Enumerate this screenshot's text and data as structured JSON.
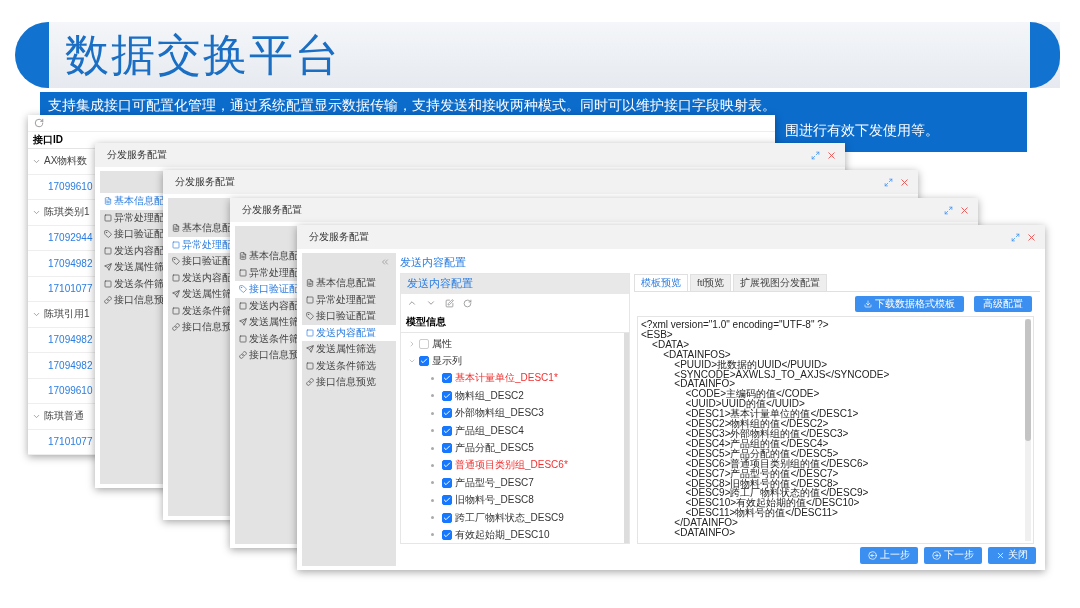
{
  "header": {
    "title": "数据交换平台"
  },
  "description": {
    "lines": [
      "支持集成接口可配置化管理，通过系统配置显示数据传输，支持发送和接收两种模式。同时可以维护接口字段映射表。",
      "围进行有效下发使用等。"
    ]
  },
  "table_window": {
    "column": "接口ID",
    "groups": [
      {
        "label": "AX物料数",
        "expanded": true,
        "rows": [
          "17099610"
        ]
      },
      {
        "label": "陈琪类别1",
        "expanded": true,
        "rows": [
          "17092944",
          "17094982",
          "17101077"
        ]
      },
      {
        "label": "陈琪引用1",
        "expanded": true,
        "rows": [
          "17094982",
          "17094982",
          "17099610"
        ]
      },
      {
        "label": "陈琪普通",
        "expanded": true,
        "rows": [
          "17101077"
        ]
      }
    ]
  },
  "back_windows": [
    {
      "title": "分发服务配置",
      "menu": [
        {
          "label": "基本信息配",
          "selected": true
        },
        {
          "label": "异常处理配",
          "selected": false
        },
        {
          "label": "接口验证配",
          "selected": false
        },
        {
          "label": "发送内容配",
          "selected": false
        },
        {
          "label": "发送属性筛",
          "selected": false
        },
        {
          "label": "发送条件筛",
          "selected": false
        },
        {
          "label": "接口信息预",
          "selected": false
        }
      ]
    },
    {
      "title": "分发服务配置",
      "menu": [
        {
          "label": "基本信息配",
          "selected": false
        },
        {
          "label": "异常处理配",
          "selected": true
        },
        {
          "label": "接口验证配",
          "selected": false
        },
        {
          "label": "发送内容配",
          "selected": false
        },
        {
          "label": "发送属性筛",
          "selected": false
        },
        {
          "label": "发送条件筛",
          "selected": false
        },
        {
          "label": "接口信息预",
          "selected": false
        }
      ]
    },
    {
      "title": "分发服务配置",
      "menu": [
        {
          "label": "基本信息配",
          "selected": false
        },
        {
          "label": "异常处理配",
          "selected": false
        },
        {
          "label": "接口验证配",
          "selected": true
        },
        {
          "label": "发送内容配",
          "selected": false
        },
        {
          "label": "发送属性筛",
          "selected": false
        },
        {
          "label": "发送条件筛",
          "selected": false
        },
        {
          "label": "接口信息预",
          "selected": false
        }
      ]
    }
  ],
  "front_window": {
    "title": "分发服务配置",
    "menu": [
      {
        "label": "基本信息配置",
        "selected": false
      },
      {
        "label": "异常处理配置",
        "selected": false
      },
      {
        "label": "接口验证配置",
        "selected": false
      },
      {
        "label": "发送内容配置",
        "selected": true
      },
      {
        "label": "发送属性筛选",
        "selected": false
      },
      {
        "label": "发送条件筛选",
        "selected": false
      },
      {
        "label": "接口信息预览",
        "selected": false
      }
    ],
    "breadcrumb": "发送内容配置",
    "panel_title": "发送内容配置",
    "tree_header": "模型信息",
    "tree": [
      {
        "label": "属性",
        "checked": false,
        "expanded": false
      },
      {
        "label": "显示列",
        "checked": true,
        "expanded": true,
        "children": [
          {
            "label": "基本计量单位_DESC1*",
            "checked": true,
            "required": true
          },
          {
            "label": "物料组_DESC2",
            "checked": true,
            "required": false
          },
          {
            "label": "外部物料组_DESC3",
            "checked": true,
            "required": false
          },
          {
            "label": "产品组_DESC4",
            "checked": true,
            "required": false
          },
          {
            "label": "产品分配_DESC5",
            "checked": true,
            "required": false
          },
          {
            "label": "普通项目类别组_DESC6*",
            "checked": true,
            "required": true
          },
          {
            "label": "产品型号_DESC7",
            "checked": true,
            "required": false
          },
          {
            "label": "旧物料号_DESC8",
            "checked": true,
            "required": false
          },
          {
            "label": "跨工厂物料状态_DESC9",
            "checked": true,
            "required": false
          },
          {
            "label": "有效起始期_DESC10",
            "checked": true,
            "required": false
          }
        ]
      }
    ],
    "tabs": [
      {
        "label": "模板预览",
        "selected": true
      },
      {
        "label": "ftl预览",
        "selected": false
      },
      {
        "label": "扩展视图分发配置",
        "selected": false
      }
    ],
    "buttons": [
      {
        "label": "下载数据格式模板",
        "kind": "download"
      },
      {
        "label": "高级配置",
        "kind": "plain"
      }
    ],
    "xml": [
      "<?xml version=\"1.0\" encoding=\"UTF-8\" ?>",
      "<ESB>",
      "    <DATA>",
      "        <DATAINFOS>",
      "            <PUUID>批数据的UUID</PUUID>",
      "            <SYNCODE>AXWLSJ_TO_AXJS</SYNCODE>",
      "            <DATAINFO>",
      "                <CODE>主编码的值</CODE>",
      "                <UUID>UUID的值</UUID>",
      "                <DESC1>基本计量单位的值</DESC1>",
      "                <DESC2>物料组的值</DESC2>",
      "                <DESC3>外部物料组的值</DESC3>",
      "                <DESC4>产品组的值</DESC4>",
      "                <DESC5>产品分配的值</DESC5>",
      "                <DESC6>普通项目类别组的值</DESC6>",
      "                <DESC7>产品型号的值</DESC7>",
      "                <DESC8>旧物料号的值</DESC8>",
      "                <DESC9>跨工厂物料状态的值</DESC9>",
      "                <DESC10>有效起始期的值</DESC10>",
      "                <DESC11>物料号的值</DESC11>",
      "            </DATAINFO>",
      "            <DATAINFO>"
    ],
    "footer": [
      {
        "label": "上一步",
        "kind": "prev"
      },
      {
        "label": "下一步",
        "kind": "next"
      },
      {
        "label": "关闭",
        "kind": "close"
      }
    ]
  }
}
